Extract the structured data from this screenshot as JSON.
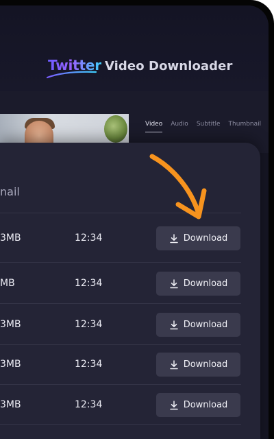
{
  "header": {
    "logo_twitter": "Twitter",
    "logo_rest": "Video Downloader",
    "accent_gradient": [
      "#6d5bff",
      "#9a63ff",
      "#3fd0ff"
    ]
  },
  "tabs": [
    {
      "label": "Video",
      "active": true
    },
    {
      "label": "Audio",
      "active": false
    },
    {
      "label": "Subtitle",
      "active": false
    },
    {
      "label": "Thumbnail",
      "active": false
    }
  ],
  "panel": {
    "header_partial": "nail"
  },
  "rows": [
    {
      "size": "3MB",
      "duration": "12:34",
      "button_label": "Download"
    },
    {
      "size": "MB",
      "duration": "12:34",
      "button_label": "Download"
    },
    {
      "size": "3MB",
      "duration": "12:34",
      "button_label": "Download"
    },
    {
      "size": "3MB",
      "duration": "12:34",
      "button_label": "Download"
    },
    {
      "size": "3MB",
      "duration": "12:34",
      "button_label": "Download"
    }
  ],
  "icons": {
    "download": "download-icon",
    "pointer_arrow": "orange-arrow-icon"
  },
  "colors": {
    "arrow": "#f7931e",
    "panel": "#242436",
    "button": "#3a3a4d"
  }
}
